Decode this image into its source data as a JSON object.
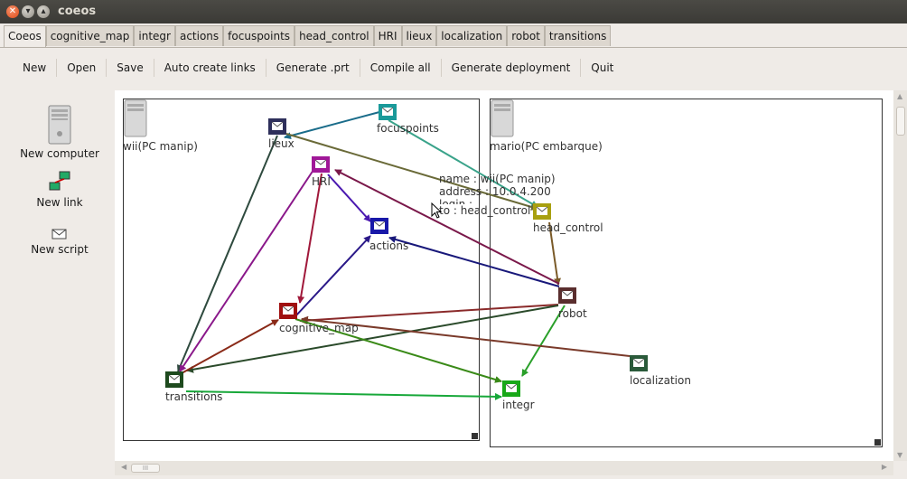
{
  "window": {
    "title": "coeos"
  },
  "tabs": [
    "Coeos",
    "cognitive_map",
    "integr",
    "actions",
    "focuspoints",
    "head_control",
    "HRI",
    "lieux",
    "localization",
    "robot",
    "transitions"
  ],
  "toolbar": [
    "New",
    "Open",
    "Save",
    "Auto create links",
    "Generate .prt",
    "Compile all",
    "Generate deployment",
    "Quit"
  ],
  "sidebar": {
    "new_computer": "New computer",
    "new_link": "New link",
    "new_script": "New script"
  },
  "computers": [
    {
      "label": "wii(PC manip)"
    },
    {
      "label": "mario(PC embarque)"
    }
  ],
  "nodes": {
    "lieux": {
      "label": "lieux",
      "color": "#2e2f5b"
    },
    "focuspoints": {
      "label": "focuspoints",
      "color": "#1a9a9a"
    },
    "HRI": {
      "label": "HRI",
      "color": "#a01898"
    },
    "actions": {
      "label": "actions",
      "color": "#1818a8"
    },
    "head_control": {
      "label": "head_control",
      "color": "#a8a010"
    },
    "robot": {
      "label": "robot",
      "color": "#5a2e2e"
    },
    "cognitive_map": {
      "label": "cognitive_map",
      "color": "#a01010"
    },
    "transitions": {
      "label": "transitions",
      "color": "#1e4a1e"
    },
    "integr": {
      "label": "integr",
      "color": "#18a818"
    },
    "localization": {
      "label": "localization",
      "color": "#2a5a3a"
    }
  },
  "tooltip": {
    "name": "name : wii(PC manip)",
    "address": "address : 10.0.4.200",
    "login": "login :",
    "to": "to : head_control"
  },
  "hscroll_label": "III"
}
